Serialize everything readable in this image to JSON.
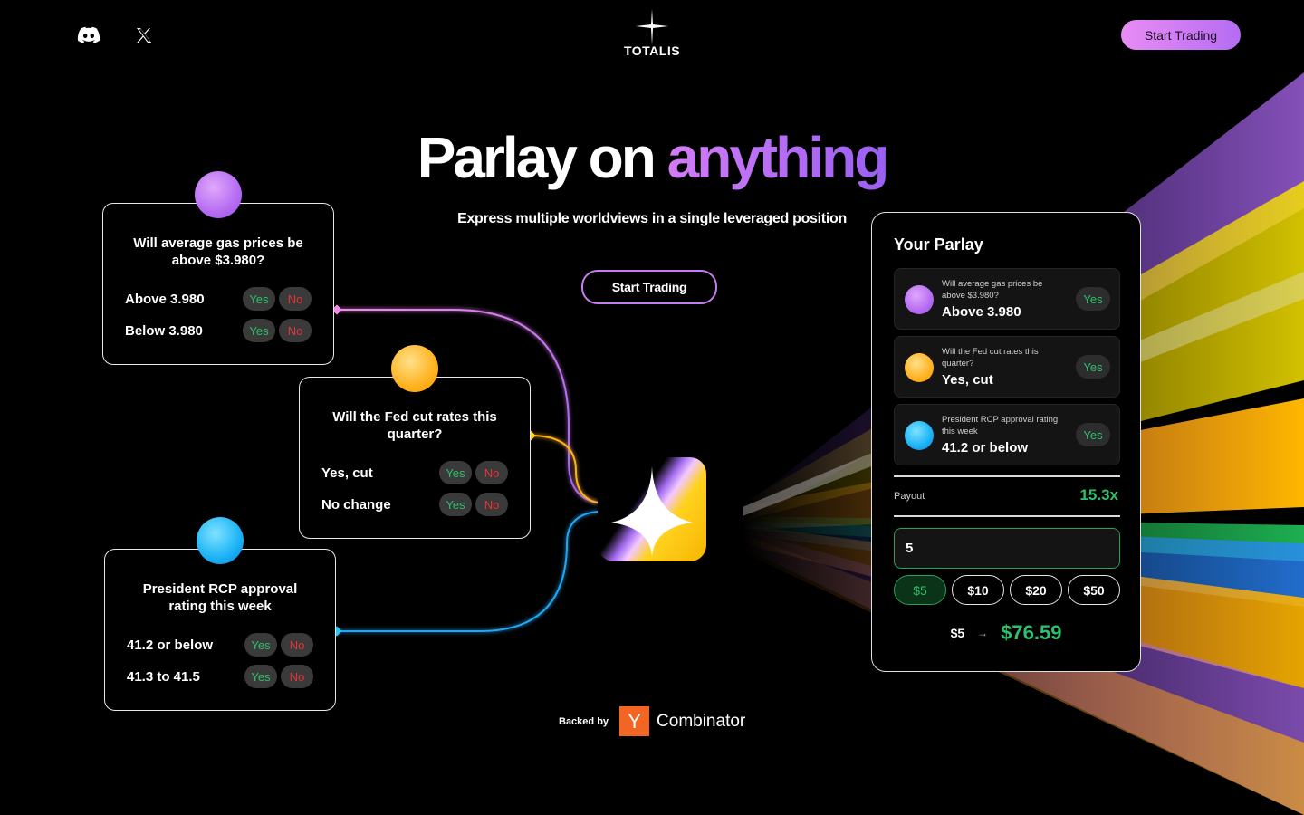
{
  "header": {
    "brand_name": "TOTALIS",
    "cta_label": "Start Trading",
    "social": [
      {
        "icon": "discord-icon"
      },
      {
        "icon": "x-twitter-icon"
      }
    ]
  },
  "hero": {
    "title_plain": "Parlay on",
    "title_accent": "anything",
    "subtitle": "Express multiple worldviews in a single leveraged position",
    "cta_label": "Start Trading"
  },
  "markets": [
    {
      "question": "Will average gas prices be above $3.980?",
      "orb_color": "#c77cf2",
      "outcomes": [
        {
          "label": "Above 3.980",
          "yes": "Yes",
          "no": "No"
        },
        {
          "label": "Below 3.980",
          "yes": "Yes",
          "no": "No"
        }
      ]
    },
    {
      "question": "Will the Fed cut rates this quarter?",
      "orb_color": "#ffb21f",
      "outcomes": [
        {
          "label": "Yes, cut",
          "yes": "Yes",
          "no": "No"
        },
        {
          "label": "No change",
          "yes": "Yes",
          "no": "No"
        }
      ]
    },
    {
      "question": "President RCP approval rating this week",
      "orb_color": "#1ab2f5",
      "outcomes": [
        {
          "label": "41.2 or below",
          "yes": "Yes",
          "no": "No"
        },
        {
          "label": "41.3 to 41.5",
          "yes": "Yes",
          "no": "No"
        }
      ]
    }
  ],
  "parlay": {
    "title": "Your Parlay",
    "legs": [
      {
        "question": "Will average gas prices be above $3.980?",
        "answer": "Above 3.980",
        "side": "Yes"
      },
      {
        "question": "Will the Fed cut rates this quarter?",
        "answer": "Yes, cut",
        "side": "Yes"
      },
      {
        "question": "President RCP approval rating this week",
        "answer": "41.2 or below",
        "side": "Yes"
      }
    ],
    "payout_label": "Payout",
    "payout_value": "15.3x",
    "amount_value": "5",
    "chips": [
      "$5",
      "$10",
      "$20",
      "$50"
    ],
    "active_chip": "$5",
    "result_from": "$5",
    "result_arrow": "→",
    "result_to": "$76.59"
  },
  "footer": {
    "backed_label": "Backed by",
    "yc_letter": "Y",
    "yc_name": "Combinator"
  },
  "colors": {
    "accent_purple": "#c77cf2",
    "accent_green": "#2fbf6a",
    "accent_red": "#e5353b",
    "yc_orange": "#f26522"
  }
}
